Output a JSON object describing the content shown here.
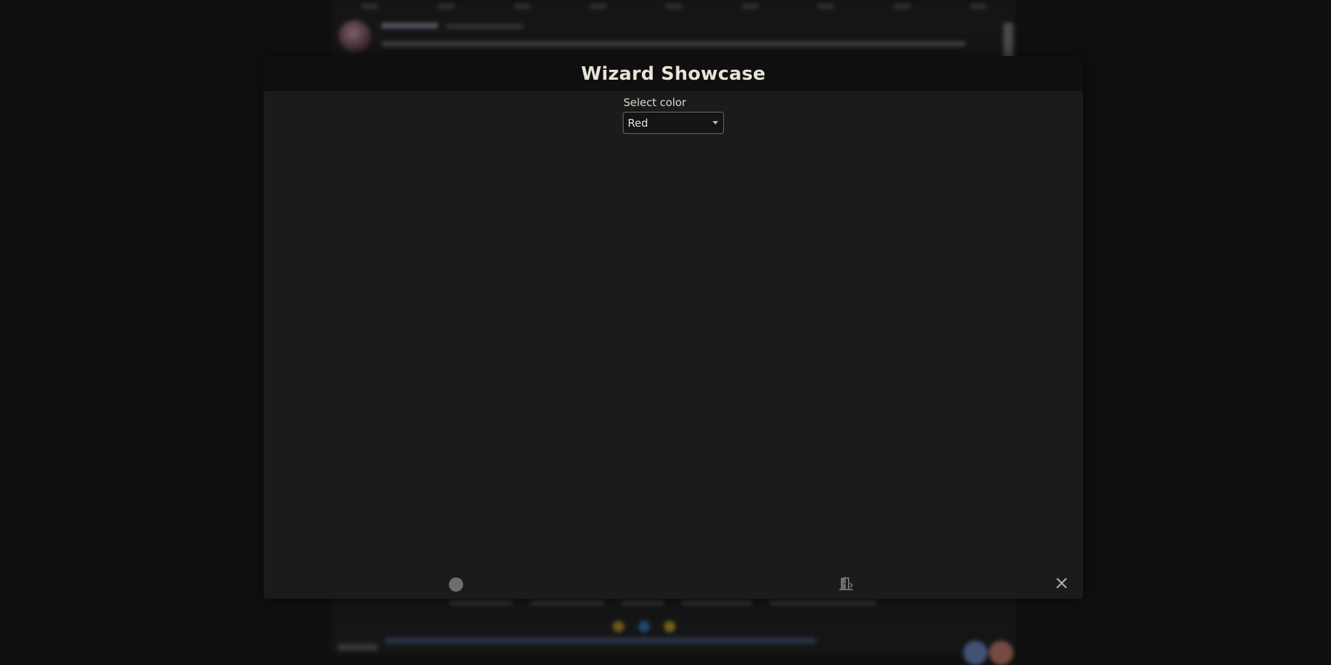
{
  "modal": {
    "title": "Wizard Showcase",
    "field": {
      "label": "Select color",
      "selected_value": "Red"
    },
    "footer": {
      "left_icon": "circle-icon",
      "center_icon": "door-exit-icon",
      "right_icon": "close-icon"
    }
  },
  "colors": {
    "page_background": "#101010",
    "modal_background": "#1b1b1b",
    "header_background": "#0f0f0f",
    "title_text": "#e8e3d6",
    "icon_gray": "#6e6e6e"
  }
}
